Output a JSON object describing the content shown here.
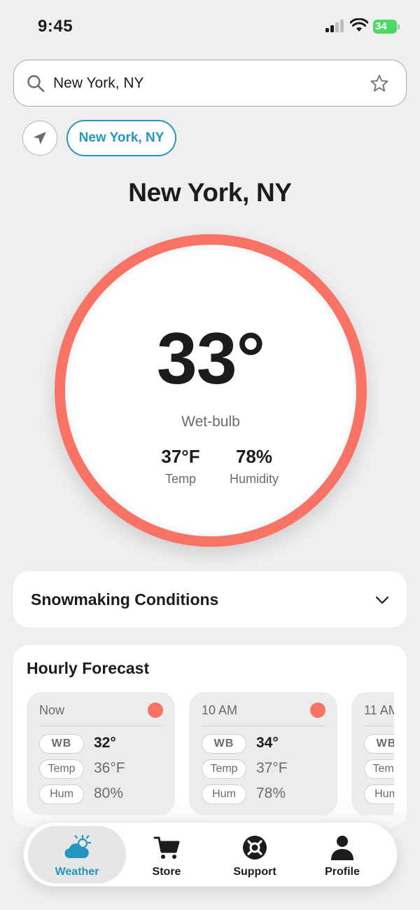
{
  "status_bar": {
    "time": "9:45",
    "battery": "34"
  },
  "search": {
    "value": "New York, NY",
    "placeholder": ""
  },
  "location_chip": "New York, NY",
  "city_title": "New York, NY",
  "gauge": {
    "value": "33°",
    "label": "Wet-bulb",
    "temp_value": "37°F",
    "temp_label": "Temp",
    "humidity_value": "78%",
    "humidity_label": "Humidity",
    "ring_color": "#f87266"
  },
  "snowmaking": {
    "title": "Snowmaking Conditions"
  },
  "hourly": {
    "title": "Hourly Forecast",
    "row_labels": {
      "wb": "WB",
      "temp": "Temp",
      "hum": "Hum"
    },
    "items": [
      {
        "time": "Now",
        "wb": "32°",
        "temp": "36°F",
        "hum": "80%",
        "status_color": "#f87266"
      },
      {
        "time": "10 AM",
        "wb": "34°",
        "temp": "37°F",
        "hum": "78%",
        "status_color": "#f87266"
      },
      {
        "time": "11 AM",
        "wb": "",
        "temp": "",
        "hum": "",
        "status_color": "#f87266"
      }
    ]
  },
  "tabs": [
    {
      "label": "Weather",
      "icon": "weather-icon",
      "active": true
    },
    {
      "label": "Store",
      "icon": "cart-icon",
      "active": false
    },
    {
      "label": "Support",
      "icon": "lifebuoy-icon",
      "active": false
    },
    {
      "label": "Profile",
      "icon": "person-icon",
      "active": false
    }
  ],
  "colors": {
    "accent": "#2596be",
    "alert": "#f87266"
  }
}
